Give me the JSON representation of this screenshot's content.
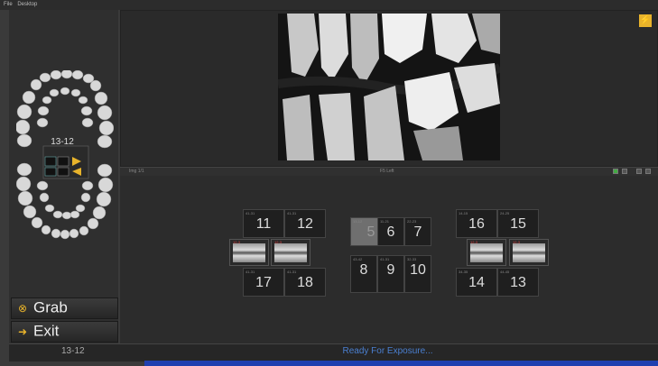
{
  "menubar": {
    "items": [
      "File",
      "Desktop"
    ]
  },
  "chart": {
    "selected_label": "13-12"
  },
  "divider": {
    "left": "Img 1/1",
    "center": "F5 Left"
  },
  "tiles": {
    "t11": "11",
    "t12": "12",
    "t16": "16",
    "t15": "15",
    "t5": "5",
    "t6": "6",
    "t7": "7",
    "t8": "8",
    "t9": "9",
    "t10": "10",
    "t17": "17",
    "t18": "18",
    "t14": "14",
    "t13": "13"
  },
  "buttons": {
    "grab_label": "Grab",
    "exit_label": "Exit"
  },
  "status": {
    "tooth": "13-12",
    "message": "Ready For Exposure..."
  },
  "colors": {
    "accent": "#e8b32b",
    "status_text": "#4a7fd0",
    "selected_tile": "#6f6f6f"
  },
  "icons": {
    "help": "help-icon",
    "grab": "grab-icon",
    "exit": "exit-icon"
  }
}
